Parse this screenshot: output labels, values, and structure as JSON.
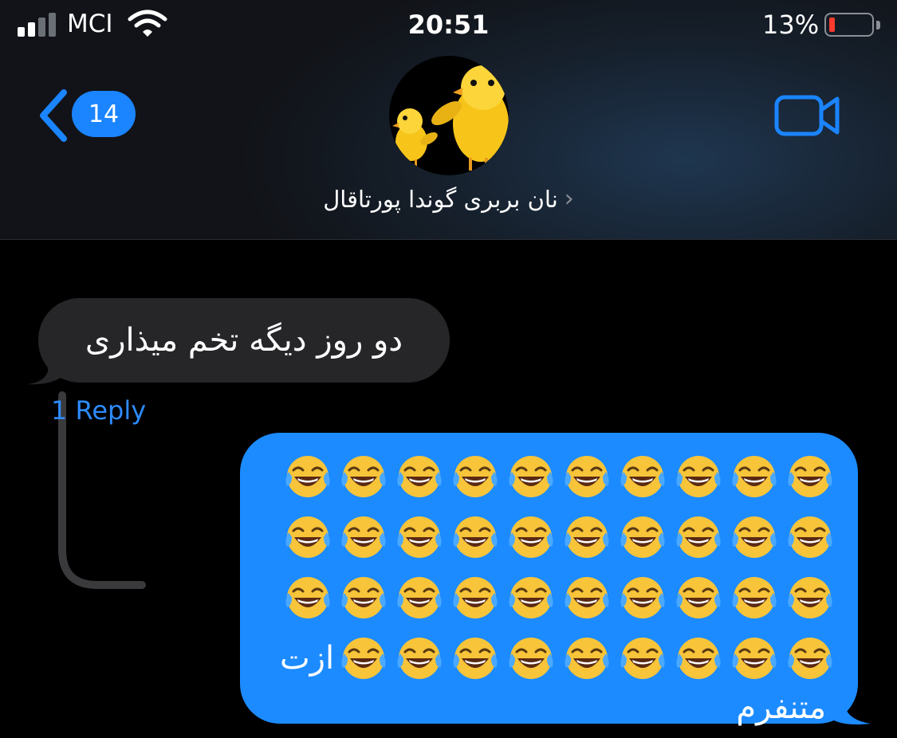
{
  "status_bar": {
    "carrier": "MCI",
    "time": "20:51",
    "battery_percent": "13%",
    "battery_level": 0.13,
    "battery_color": "#ff3b30",
    "signal_bars_active": 2,
    "signal_bars_total": 4
  },
  "nav": {
    "back_count": "14",
    "contact_name": "نان بربری گوندا پورتاقال",
    "accent_color": "#1b84ff",
    "video_icon": "video-camera-icon",
    "avatar_icon": "chick-avatar"
  },
  "messages": {
    "incoming": {
      "text": "دو روز دیگه تخم میذاری",
      "reply_label": "1 Reply",
      "bubble_color": "#262629"
    },
    "outgoing": {
      "emoji_name": "face-with-tears-of-joy",
      "emoji_count": 40,
      "word_inline": "ازت",
      "word_second_line": "متنفرم",
      "bubble_color": "#1c8bff"
    }
  }
}
